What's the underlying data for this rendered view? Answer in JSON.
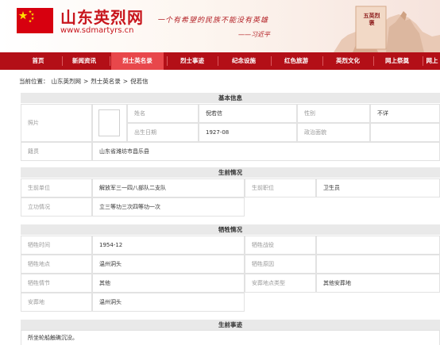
{
  "header": {
    "site_name": "山东英烈网",
    "site_url": "www.sdmartyrs.cn",
    "slogan": "一个有希望的民族不能没有英雄",
    "slogan_author": "——习近平",
    "monument_text": "五英烈褒"
  },
  "nav": {
    "items": [
      {
        "label": "首页",
        "active": false
      },
      {
        "label": "新闻资讯",
        "active": false
      },
      {
        "label": "烈士英名录",
        "active": true
      },
      {
        "label": "烈士事迹",
        "active": false
      },
      {
        "label": "纪念设施",
        "active": false
      },
      {
        "label": "红色旅游",
        "active": false
      },
      {
        "label": "英烈文化",
        "active": false
      },
      {
        "label": "网上祭奠",
        "active": false
      },
      {
        "label": "网上",
        "active": false
      }
    ]
  },
  "breadcrumb": {
    "prefix": "当前位置：",
    "items": [
      "山东英烈网",
      ">",
      "烈士英名录",
      ">",
      "倪若信"
    ]
  },
  "basic_info": {
    "title": "基本信息",
    "photo_label": "照片",
    "name_label": "姓名",
    "name": "倪若信",
    "gender_label": "性别",
    "gender": "不详",
    "birth_label": "出生日期",
    "birth": "1927-08",
    "political_label": "政治面貌",
    "political": "",
    "hometown_label": "籍贯",
    "hometown": "山东省潍坊市昌乐县"
  },
  "life_info": {
    "title": "生前情况",
    "unit_label": "生前单位",
    "unit": "解放军三一四八部队二支队",
    "position_label": "生前职位",
    "position": "卫生员",
    "merit_label": "立功情况",
    "merit": "立三等功三次四等功一次"
  },
  "sacrifice_info": {
    "title": "牺牲情况",
    "time_label": "牺牲时间",
    "time": "1954-12",
    "battle_label": "牺牲战役",
    "battle": "",
    "place_label": "牺牲地点",
    "place": "温州洞头",
    "reason_label": "牺牲原因",
    "reason": "",
    "detail_label": "牺牲情节",
    "detail": "其他",
    "burial_type_label": "安葬地点类型",
    "burial_type": "其他安葬地",
    "burial_label": "安葬地",
    "burial": "温州洞头"
  },
  "deeds": {
    "title": "生前事迹",
    "text": "所坐轮船触礁沉没。"
  },
  "colors": {
    "brand_red": "#c8161d",
    "nav_bg": "#b30f17",
    "nav_active": "#e8474b",
    "section_bg": "#e9e9e9",
    "label_gray": "#999999"
  },
  "icons": [
    "china-flag-icon",
    "monument-icon"
  ]
}
